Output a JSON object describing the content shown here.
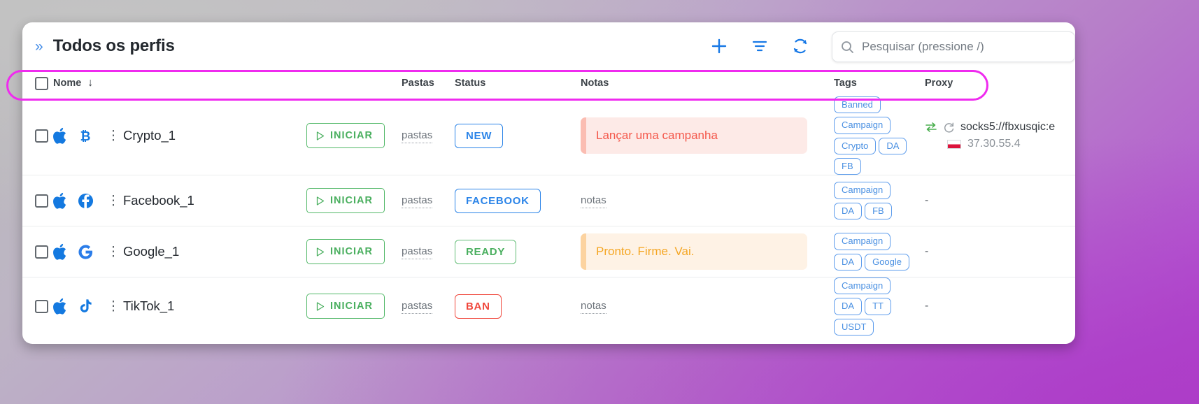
{
  "header": {
    "title": "Todos os perfis",
    "collapse_icon": "double-chevron-right-icon",
    "add_icon": "plus-icon",
    "filter_icon": "filter-icon",
    "refresh_icon": "refresh-icon",
    "search_placeholder": "Pesquisar (pressione /)",
    "search_value": ""
  },
  "table": {
    "columns": {
      "name": "Nome",
      "sort_arrow": "↓",
      "folders": "Pastas",
      "status": "Status",
      "notes": "Notas",
      "tags": "Tags",
      "proxy": "Proxy"
    },
    "rows": [
      {
        "name": "Crypto_1",
        "platform_icons": [
          "apple-icon",
          "bitcoin-icon"
        ],
        "start_label": "INICIAR",
        "folders_label": "pastas",
        "status": "NEW",
        "status_style": "new",
        "note_text": "Lançar uma campanha",
        "note_style": "red",
        "tags": [
          "Banned",
          "Campaign",
          "Crypto",
          "DA",
          "FB"
        ],
        "proxy": {
          "type": "value",
          "address": "socks5://fbxusqic:e",
          "ip": "37.30.55.4",
          "flag": "poland-flag-icon"
        }
      },
      {
        "name": "Facebook_1",
        "platform_icons": [
          "apple-icon",
          "facebook-icon"
        ],
        "start_label": "INICIAR",
        "folders_label": "pastas",
        "status": "FACEBOOK",
        "status_style": "facebook",
        "note_text": "notas",
        "note_style": "link",
        "tags": [
          "Campaign",
          "DA",
          "FB"
        ],
        "proxy": {
          "type": "empty",
          "dash": "-"
        }
      },
      {
        "name": "Google_1",
        "platform_icons": [
          "apple-icon",
          "google-icon"
        ],
        "start_label": "INICIAR",
        "folders_label": "pastas",
        "status": "READY",
        "status_style": "ready",
        "note_text": "Pronto. Firme. Vai.",
        "note_style": "amber",
        "tags": [
          "Campaign",
          "DA",
          "Google"
        ],
        "proxy": {
          "type": "empty",
          "dash": "-"
        }
      },
      {
        "name": "TikTok_1",
        "platform_icons": [
          "apple-icon",
          "tiktok-icon"
        ],
        "start_label": "INICIAR",
        "folders_label": "pastas",
        "status": "BAN",
        "status_style": "ban",
        "note_text": "notas",
        "note_style": "link",
        "tags": [
          "Campaign",
          "DA",
          "TT",
          "USDT"
        ],
        "proxy": {
          "type": "empty",
          "dash": "-"
        }
      }
    ]
  },
  "colors": {
    "accent_blue": "#1879e6",
    "green": "#4aaf5f",
    "red": "#f0473c",
    "amber": "#f5a623",
    "highlight_ring": "#ef2bef"
  }
}
